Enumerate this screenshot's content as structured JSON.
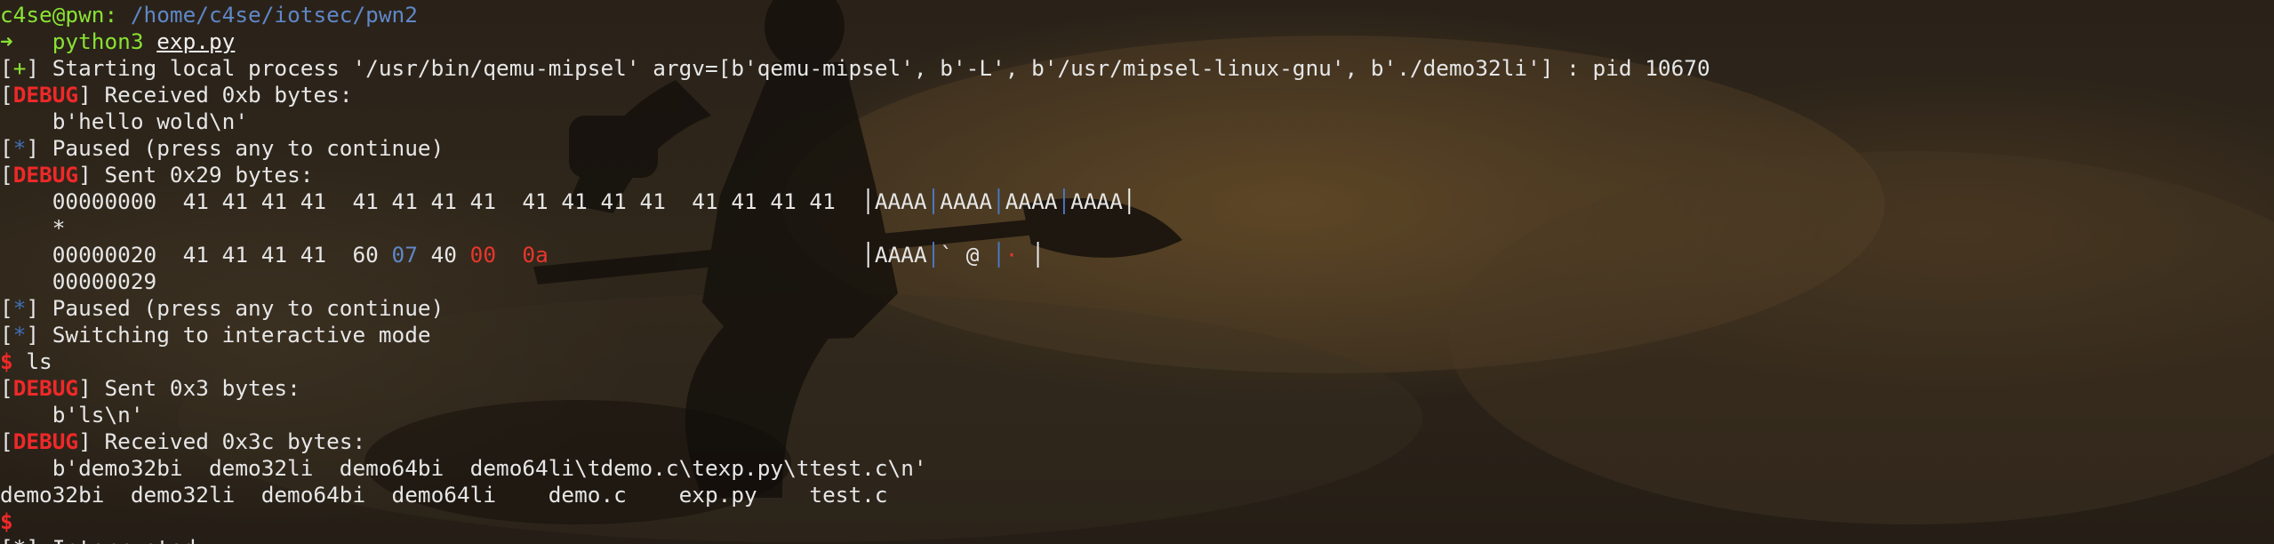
{
  "terminal": {
    "cwd_user": "c4se@pwn:",
    "cwd_path": " /home/c4se/iotsec/pwn2",
    "prompt_arrow": "➜",
    "cmd1_program": "python3",
    "cmd1_file": "exp.py",
    "l3_marker": "+",
    "l3_text": " Starting local process '/usr/bin/qemu-mipsel' argv=[b'qemu-mipsel', b'-L', b'/usr/mipsel-linux-gnu', b'./demo32li'] : pid 10670",
    "debug_tag": "DEBUG",
    "l4_text": " Received 0xb bytes:",
    "l5_text": "    b'hello wold\\n'",
    "star_marker": "*",
    "l6_text": " Paused (press any to continue)",
    "l7_text": " Sent 0x29 bytes:",
    "hex1_prefix": "    00000000  41 41 41 41  41 41 41 41  41 41 41 41  41 41 41 41  ",
    "hex1_ascii": [
      "AAAA",
      "AAAA",
      "AAAA",
      "AAAA"
    ],
    "hex_star": "    *",
    "hex2_prefix": "    00000020  41 41 41 41  60 ",
    "hex2_b1": "07",
    "hex2_b2": " 40 ",
    "hex2_b3": "00",
    "hex2_b4": "0a",
    "hex2_ascii1": "AAAA",
    "hex2_ascii2": "` @ ",
    "hex2_ascii3": "·",
    "hex2_ascii4": " ",
    "hex_end": "    00000029",
    "l12_text": " Paused (press any to continue)",
    "l13_text": " Switching to interactive mode",
    "dollar": "$",
    "l14_cmd": " ls",
    "l15_text": " Sent 0x3 bytes:",
    "l16_text": "    b'ls\\n'",
    "l17_text": " Received 0x3c bytes:",
    "l18_text": "    b'demo32bi  demo32li  demo64bi  demo64li\\tdemo.c\\texp.py\\ttest.c\\n'",
    "l19_text": "demo32bi  demo32li  demo64bi  demo64li    demo.c    exp.py    test.c",
    "l21_partial": "[*] Interrupted"
  },
  "colors": {
    "green": "#8ae234",
    "blue": "#5f87c7",
    "red": "#ef2929",
    "text": "#e6e6e6"
  }
}
